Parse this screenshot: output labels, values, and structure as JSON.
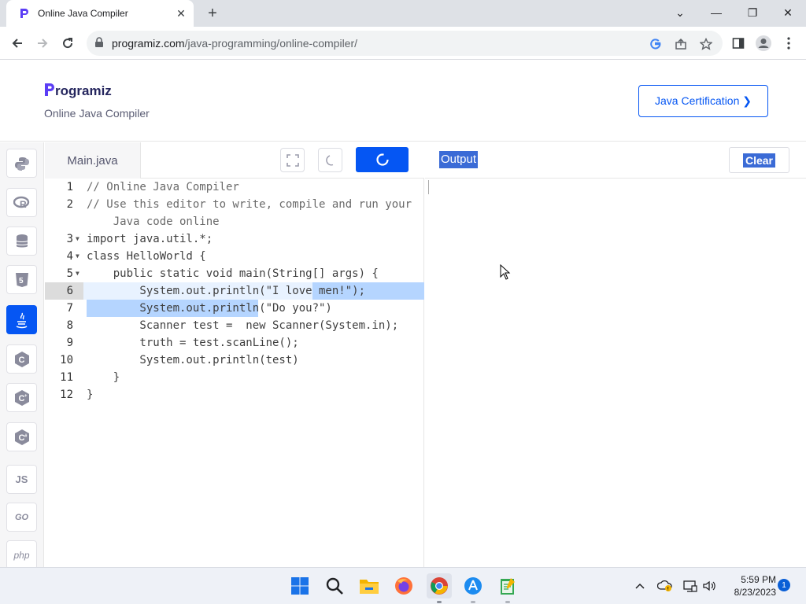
{
  "browser": {
    "tab_title": "Online Java Compiler",
    "url_host": "programiz.com",
    "url_path": "/java-programming/online-compiler/"
  },
  "site": {
    "logo_text": "rogramiz",
    "subtitle": "Online Java Compiler",
    "cert_button": "Java Certification ❯"
  },
  "sidebar": {
    "languages": [
      "python",
      "r",
      "sql",
      "html",
      "java",
      "c",
      "cpp",
      "csharp",
      "JS",
      "GO",
      "php"
    ],
    "active": "java"
  },
  "editor": {
    "file_name": "Main.java",
    "lines": [
      {
        "n": "1",
        "text": "// Online Java Compiler"
      },
      {
        "n": "2",
        "text": "// Use this editor to write, compile and run your"
      },
      {
        "n": "",
        "text": "    Java code online"
      },
      {
        "n": "3",
        "text": "import java.util.*;"
      },
      {
        "n": "4",
        "text": "class HelloWorld {"
      },
      {
        "n": "5",
        "text": "    public static void main(String[] args) {"
      },
      {
        "n": "6",
        "text": "        System.out.println(\"I love men!\");"
      },
      {
        "n": "7",
        "text": "        System.out.println(\"Do you?\")"
      },
      {
        "n": "8",
        "text": "        Scanner test =  new Scanner(System.in);"
      },
      {
        "n": "9",
        "text": "        truth = test.scanLine();"
      },
      {
        "n": "10",
        "text": "        System.out.println(test)"
      },
      {
        "n": "11",
        "text": "    }"
      },
      {
        "n": "12",
        "text": "}"
      }
    ]
  },
  "output": {
    "title": "Output",
    "clear_label": "Clear"
  },
  "taskbar": {
    "time": "5:59 PM",
    "date": "8/23/2023",
    "notifications": "1"
  },
  "colors": {
    "brand": "#0556f3",
    "selection": "#b5d5ff"
  }
}
